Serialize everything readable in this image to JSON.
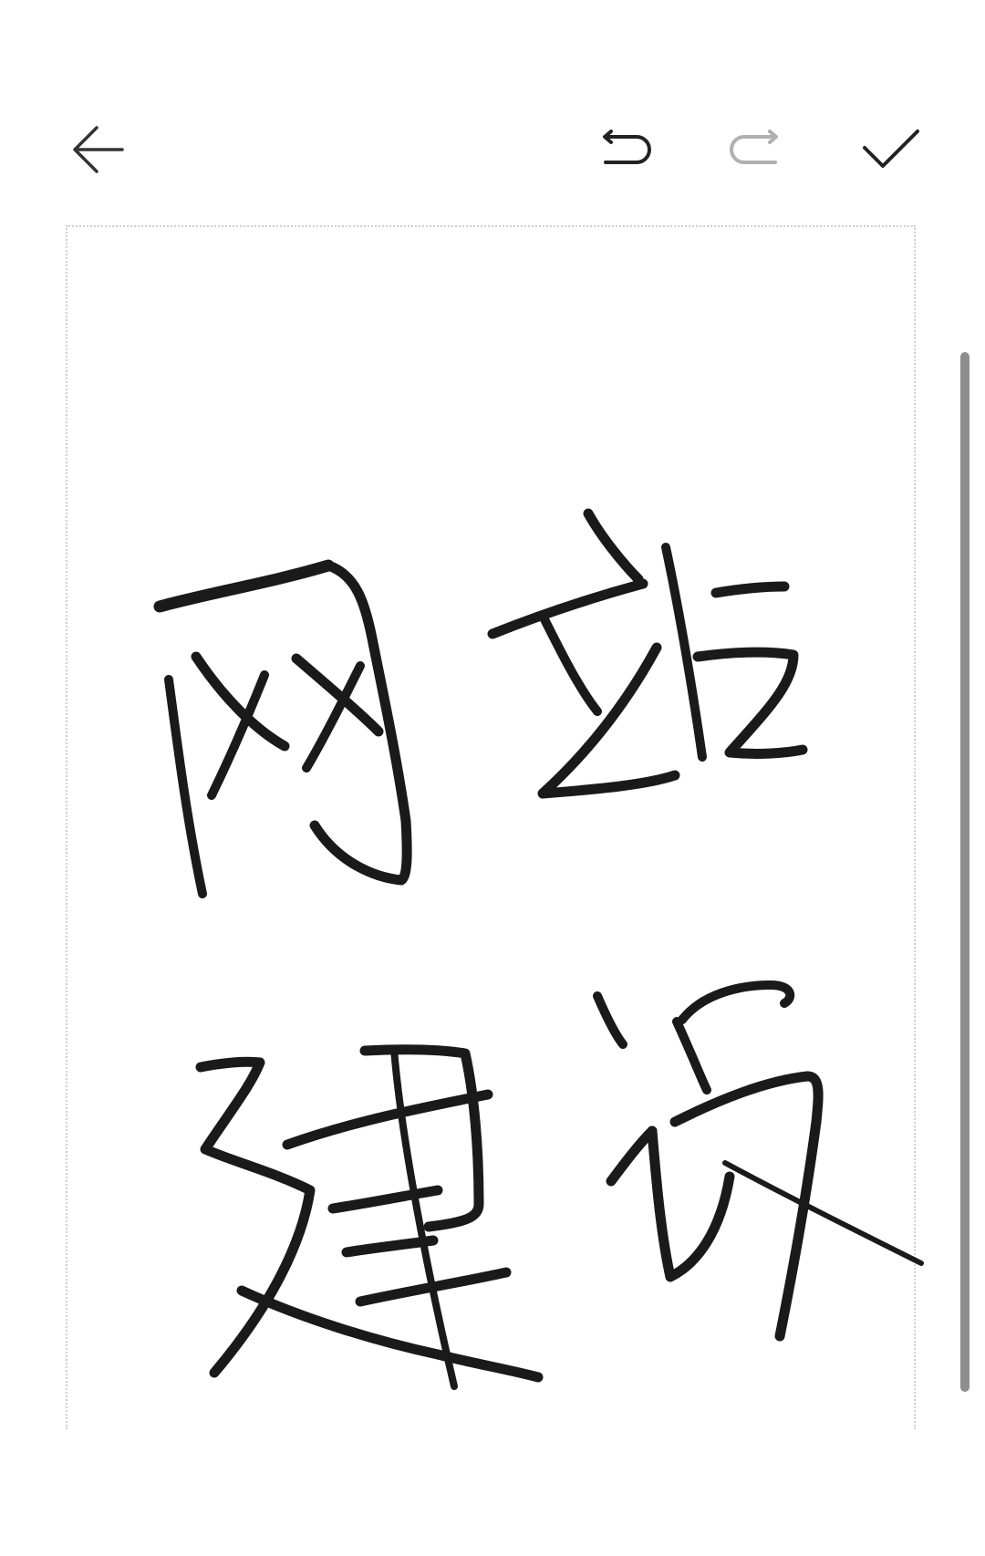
{
  "toolbar": {
    "back_icon": "arrow-left-icon",
    "undo_icon": "undo-icon",
    "redo_icon": "redo-icon",
    "done_icon": "checkmark-icon",
    "undo_enabled": true,
    "redo_enabled": false,
    "icon_color": "#333333",
    "disabled_icon_color": "#b0b0b0"
  },
  "canvas": {
    "mode": "handwriting",
    "stroke_color": "#1a1a1a",
    "border_style": "dotted",
    "border_color": "#cfcfcf"
  },
  "scrollbar": {
    "thumb_color": "#8e8e8e"
  }
}
